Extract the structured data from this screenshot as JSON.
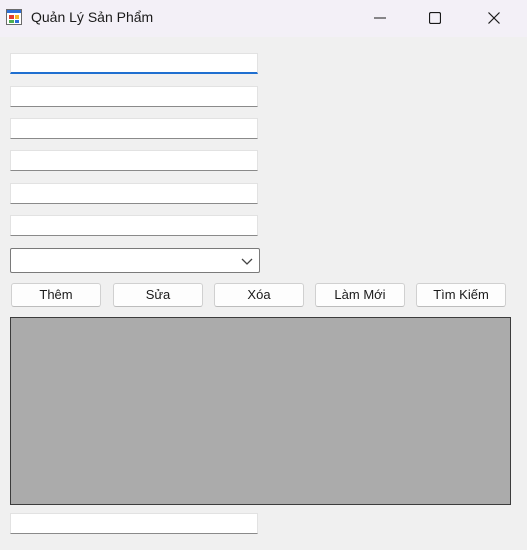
{
  "window": {
    "title": "Quản Lý Sản Phẩm",
    "app_icon": "winforms-app-icon",
    "caption_buttons": [
      "minimize-icon",
      "maximize-icon",
      "close-icon"
    ]
  },
  "form": {
    "fields": [
      {
        "value": "",
        "focused": true
      },
      {
        "value": ""
      },
      {
        "value": ""
      },
      {
        "value": ""
      },
      {
        "value": ""
      },
      {
        "value": ""
      }
    ],
    "combo": {
      "selected": "",
      "icon": "chevron-down-icon"
    },
    "buttons": {
      "add": "Thêm",
      "edit": "Sửa",
      "delete": "Xóa",
      "refresh": "Làm Mới",
      "search": "Tìm Kiếm"
    },
    "grid": {
      "background": "#ababab",
      "rows": []
    },
    "bottom_field": {
      "value": ""
    }
  },
  "colors": {
    "focus_accent": "#1f6fd0",
    "window_bg": "#f0f0f0",
    "titlebar_bg": "#f3f0f7"
  }
}
